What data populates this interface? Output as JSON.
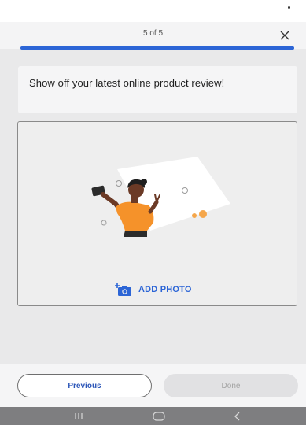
{
  "header": {
    "step_label": "5 of 5",
    "close_icon": "close-icon"
  },
  "progress": {
    "fraction": 1.0,
    "color": "#2c65d6"
  },
  "prompt": {
    "text": "Show off your latest online product review!"
  },
  "photo_area": {
    "illustration": "selfie-illustration",
    "add_photo_icon": "add-photo-camera-icon",
    "add_photo_label": "ADD PHOTO"
  },
  "footer": {
    "previous_label": "Previous",
    "done_label": "Done"
  },
  "nav_bar": {
    "recents_icon": "recents-icon",
    "home_icon": "home-icon",
    "back_icon": "back-icon"
  },
  "colors": {
    "accent": "#2c65d6",
    "illustration_orange": "#f5922a",
    "illustration_bg": "#ffffff"
  }
}
